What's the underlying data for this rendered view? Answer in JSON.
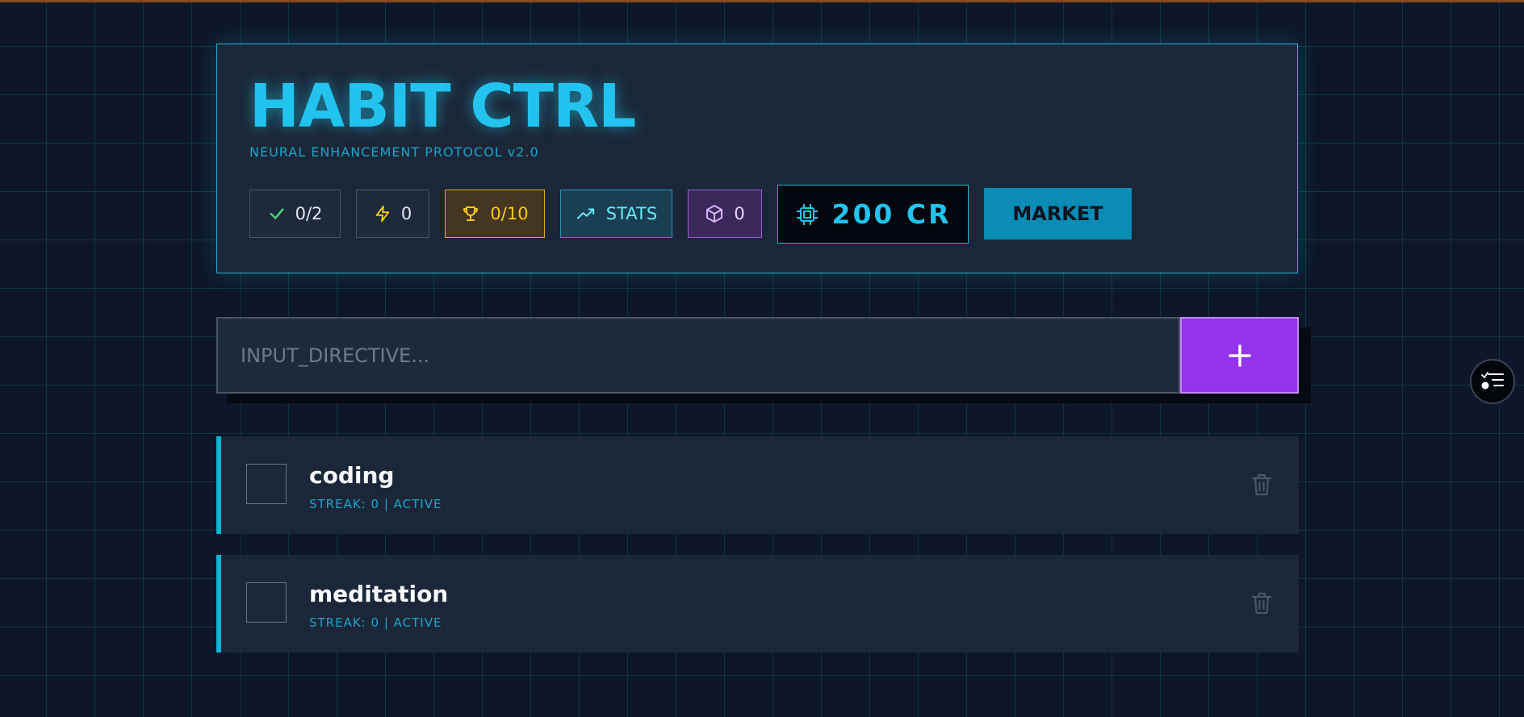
{
  "header": {
    "title": "HABIT CTRL",
    "subtitle": "NEURAL ENHANCEMENT PROTOCOL v2.0"
  },
  "stats": {
    "completed": {
      "icon": "check-icon",
      "value": "0/2",
      "color": "#4ade80"
    },
    "streak": {
      "icon": "lightning-icon",
      "value": "0",
      "color": "#facc15"
    },
    "achievements": {
      "icon": "trophy-icon",
      "value": "0/10",
      "color": "#facc15"
    },
    "stats_button": {
      "icon": "trending-up-icon",
      "label": "STATS",
      "color": "#67e8f9"
    },
    "inventory": {
      "icon": "cube-icon",
      "value": "0",
      "color": "#d8b4fe"
    },
    "credits": {
      "icon": "cpu-chip-icon",
      "value": "200 CR",
      "color": "#22c3ee"
    },
    "market_label": "MARKET"
  },
  "input": {
    "placeholder": "INPUT_DIRECTIVE...",
    "value": "",
    "add_icon": "plus-icon"
  },
  "habits": [
    {
      "name": "coding",
      "meta": "STREAK: 0 | ACTIVE",
      "checked": false,
      "delete_icon": "trash-icon"
    },
    {
      "name": "meditation",
      "meta": "STREAK: 0 | ACTIVE",
      "checked": false,
      "delete_icon": "trash-icon"
    }
  ],
  "floating_button": {
    "icon": "filter-list-icon"
  },
  "colors": {
    "accent_cyan": "#22c3ee",
    "accent_purple": "#9333ea",
    "panel_bg": "#1b2739",
    "page_bg": "#0e1629"
  }
}
